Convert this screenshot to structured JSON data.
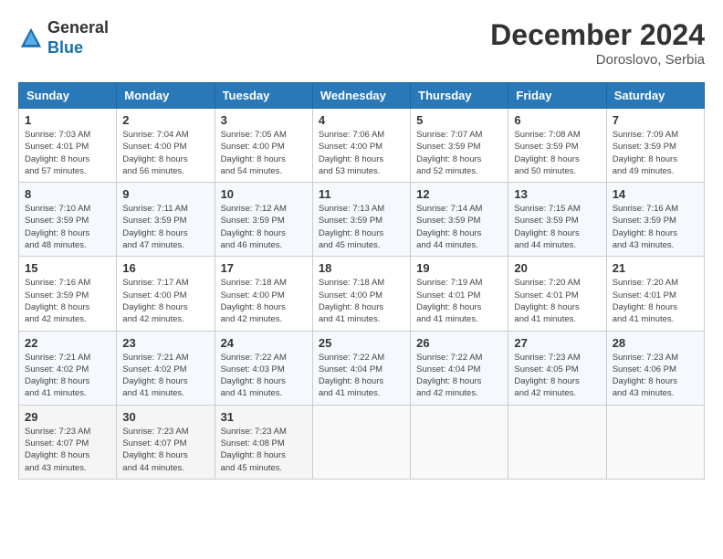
{
  "header": {
    "logo_general": "General",
    "logo_blue": "Blue",
    "month_year": "December 2024",
    "location": "Doroslovo, Serbia"
  },
  "weekdays": [
    "Sunday",
    "Monday",
    "Tuesday",
    "Wednesday",
    "Thursday",
    "Friday",
    "Saturday"
  ],
  "weeks": [
    [
      {
        "day": "1",
        "sunrise": "7:03 AM",
        "sunset": "4:01 PM",
        "daylight": "8 hours and 57 minutes."
      },
      {
        "day": "2",
        "sunrise": "7:04 AM",
        "sunset": "4:00 PM",
        "daylight": "8 hours and 56 minutes."
      },
      {
        "day": "3",
        "sunrise": "7:05 AM",
        "sunset": "4:00 PM",
        "daylight": "8 hours and 54 minutes."
      },
      {
        "day": "4",
        "sunrise": "7:06 AM",
        "sunset": "4:00 PM",
        "daylight": "8 hours and 53 minutes."
      },
      {
        "day": "5",
        "sunrise": "7:07 AM",
        "sunset": "3:59 PM",
        "daylight": "8 hours and 52 minutes."
      },
      {
        "day": "6",
        "sunrise": "7:08 AM",
        "sunset": "3:59 PM",
        "daylight": "8 hours and 50 minutes."
      },
      {
        "day": "7",
        "sunrise": "7:09 AM",
        "sunset": "3:59 PM",
        "daylight": "8 hours and 49 minutes."
      }
    ],
    [
      {
        "day": "8",
        "sunrise": "7:10 AM",
        "sunset": "3:59 PM",
        "daylight": "8 hours and 48 minutes."
      },
      {
        "day": "9",
        "sunrise": "7:11 AM",
        "sunset": "3:59 PM",
        "daylight": "8 hours and 47 minutes."
      },
      {
        "day": "10",
        "sunrise": "7:12 AM",
        "sunset": "3:59 PM",
        "daylight": "8 hours and 46 minutes."
      },
      {
        "day": "11",
        "sunrise": "7:13 AM",
        "sunset": "3:59 PM",
        "daylight": "8 hours and 45 minutes."
      },
      {
        "day": "12",
        "sunrise": "7:14 AM",
        "sunset": "3:59 PM",
        "daylight": "8 hours and 44 minutes."
      },
      {
        "day": "13",
        "sunrise": "7:15 AM",
        "sunset": "3:59 PM",
        "daylight": "8 hours and 44 minutes."
      },
      {
        "day": "14",
        "sunrise": "7:16 AM",
        "sunset": "3:59 PM",
        "daylight": "8 hours and 43 minutes."
      }
    ],
    [
      {
        "day": "15",
        "sunrise": "7:16 AM",
        "sunset": "3:59 PM",
        "daylight": "8 hours and 42 minutes."
      },
      {
        "day": "16",
        "sunrise": "7:17 AM",
        "sunset": "4:00 PM",
        "daylight": "8 hours and 42 minutes."
      },
      {
        "day": "17",
        "sunrise": "7:18 AM",
        "sunset": "4:00 PM",
        "daylight": "8 hours and 42 minutes."
      },
      {
        "day": "18",
        "sunrise": "7:18 AM",
        "sunset": "4:00 PM",
        "daylight": "8 hours and 41 minutes."
      },
      {
        "day": "19",
        "sunrise": "7:19 AM",
        "sunset": "4:01 PM",
        "daylight": "8 hours and 41 minutes."
      },
      {
        "day": "20",
        "sunrise": "7:20 AM",
        "sunset": "4:01 PM",
        "daylight": "8 hours and 41 minutes."
      },
      {
        "day": "21",
        "sunrise": "7:20 AM",
        "sunset": "4:01 PM",
        "daylight": "8 hours and 41 minutes."
      }
    ],
    [
      {
        "day": "22",
        "sunrise": "7:21 AM",
        "sunset": "4:02 PM",
        "daylight": "8 hours and 41 minutes."
      },
      {
        "day": "23",
        "sunrise": "7:21 AM",
        "sunset": "4:02 PM",
        "daylight": "8 hours and 41 minutes."
      },
      {
        "day": "24",
        "sunrise": "7:22 AM",
        "sunset": "4:03 PM",
        "daylight": "8 hours and 41 minutes."
      },
      {
        "day": "25",
        "sunrise": "7:22 AM",
        "sunset": "4:04 PM",
        "daylight": "8 hours and 41 minutes."
      },
      {
        "day": "26",
        "sunrise": "7:22 AM",
        "sunset": "4:04 PM",
        "daylight": "8 hours and 42 minutes."
      },
      {
        "day": "27",
        "sunrise": "7:23 AM",
        "sunset": "4:05 PM",
        "daylight": "8 hours and 42 minutes."
      },
      {
        "day": "28",
        "sunrise": "7:23 AM",
        "sunset": "4:06 PM",
        "daylight": "8 hours and 43 minutes."
      }
    ],
    [
      {
        "day": "29",
        "sunrise": "7:23 AM",
        "sunset": "4:07 PM",
        "daylight": "8 hours and 43 minutes."
      },
      {
        "day": "30",
        "sunrise": "7:23 AM",
        "sunset": "4:07 PM",
        "daylight": "8 hours and 44 minutes."
      },
      {
        "day": "31",
        "sunrise": "7:23 AM",
        "sunset": "4:08 PM",
        "daylight": "8 hours and 45 minutes."
      },
      null,
      null,
      null,
      null
    ]
  ]
}
